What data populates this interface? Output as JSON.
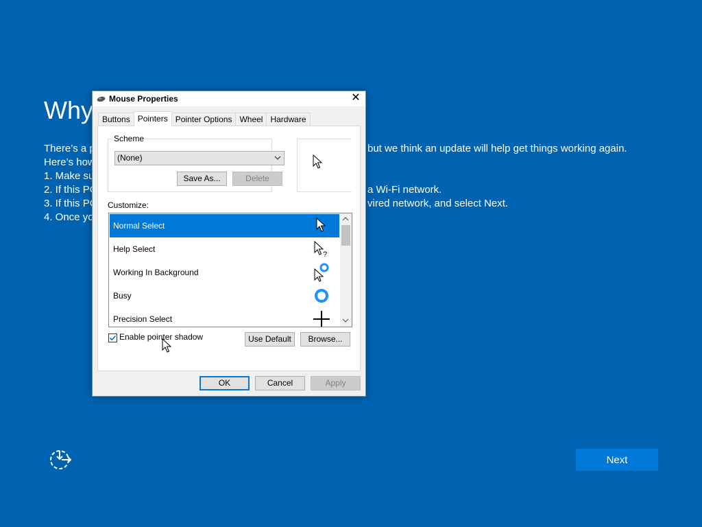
{
  "oobe": {
    "title": "Why",
    "lines": [
      "There’s a p",
      "Here’s how",
      "1. Make su",
      "2. If this PC",
      "3. If this PC",
      "4. Once yo"
    ],
    "lines_right": [
      "but we think an update will help get things working again.",
      "",
      "",
      "a Wi-Fi network.",
      "vired network, and select Next.",
      ""
    ],
    "next_label": "Next"
  },
  "dialog": {
    "title": "Mouse Properties",
    "close_label": "✕",
    "tabs": [
      "Buttons",
      "Pointers",
      "Pointer Options",
      "Wheel",
      "Hardware"
    ],
    "active_tab": "Pointers",
    "scheme_label": "Scheme",
    "scheme_value": "(None)",
    "save_as_label": "Save As...",
    "delete_label": "Delete",
    "customize_label": "Customize:",
    "cursor_items": [
      {
        "label": "Normal Select",
        "icon": "arrow-cursor-icon",
        "selected": true
      },
      {
        "label": "Help Select",
        "icon": "help-cursor-icon",
        "selected": false
      },
      {
        "label": "Working In Background",
        "icon": "working-cursor-icon",
        "selected": false
      },
      {
        "label": "Busy",
        "icon": "busy-cursor-icon",
        "selected": false
      },
      {
        "label": "Precision Select",
        "icon": "crosshair-cursor-icon",
        "selected": false
      }
    ],
    "shadow_label": "Enable pointer shadow",
    "shadow_checked": true,
    "use_default_label": "Use Default",
    "browse_label": "Browse...",
    "ok_label": "OK",
    "cancel_label": "Cancel",
    "apply_label": "Apply"
  },
  "colors": {
    "background": "#0063b1",
    "accent": "#0078d7",
    "busy_ring": "#1e90ff"
  }
}
